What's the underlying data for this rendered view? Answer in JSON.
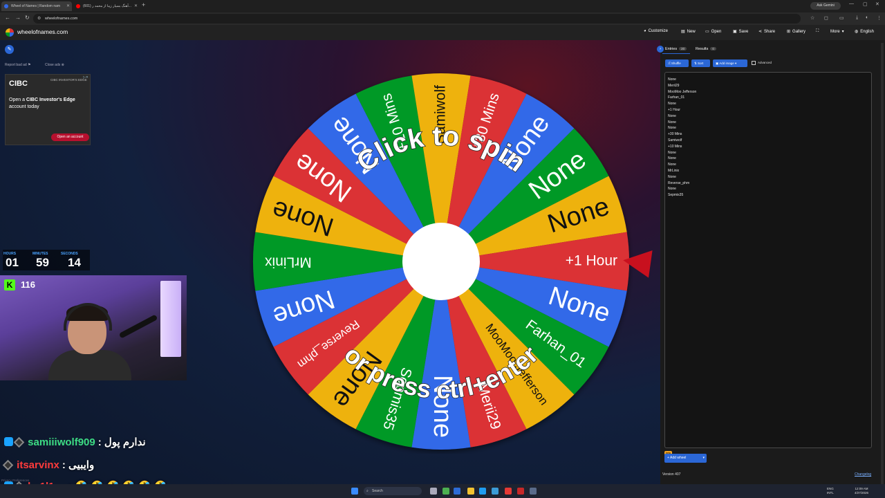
{
  "browser": {
    "tabs": [
      {
        "title": "Wheel of Names | Random nam",
        "favicon_color": "#3369e8"
      },
      {
        "title": "(601) آهنگ بسیار زیبا از محمد ر...",
        "favicon_color": "#ff0000"
      }
    ],
    "ask_gemini": "Ask Gemini",
    "url": "wheelofnames.com"
  },
  "header": {
    "site_name": "wheelofnames.com",
    "menu": [
      {
        "label": "Customize",
        "icon": "palette-icon"
      },
      {
        "label": "New",
        "icon": "file-icon"
      },
      {
        "label": "Open",
        "icon": "folder-icon"
      },
      {
        "label": "Save",
        "icon": "save-icon"
      },
      {
        "label": "Share",
        "icon": "share-icon"
      },
      {
        "label": "Gallery",
        "icon": "gallery-icon"
      },
      {
        "label": "",
        "icon": "fullscreen-icon"
      },
      {
        "label": "More",
        "icon": "chevron-down-icon"
      },
      {
        "label": "English",
        "icon": "globe-icon"
      }
    ]
  },
  "left": {
    "report_ad": "Report bad ad",
    "close_ads": "Close ads",
    "ad": {
      "brand": "CIBC",
      "product": "CIBC INVESTOR'S EDGE",
      "message_pre": "Open a ",
      "message_bold": "CIBC Investor's Edge",
      "message_post": " account today",
      "cta": "Open an account"
    }
  },
  "stream": {
    "timer": {
      "labels": [
        "HOURS",
        "MINUTES",
        "SECONDS"
      ],
      "values": [
        "01",
        "59",
        "14"
      ]
    },
    "kick_logo": "K",
    "viewers": "116",
    "chat": [
      {
        "user": "samiiiwolf909",
        "message": ": ندارم پول",
        "color": "#3ddc84"
      },
      {
        "user": "itsarvinx",
        "message": ": وایبیی",
        "color": "#ff3b3b"
      },
      {
        "user": "lm1l1ya",
        "message": ": 🤣 🤣 🤣 🤣 🤣 🤣",
        "color": "#ff3b3b"
      }
    ],
    "privacy": "Privacy Preferences"
  },
  "wheel": {
    "overlay_top": "Click to spin",
    "overlay_bottom": "or press ctrl+enter",
    "segments": [
      {
        "label": "None",
        "color": "#3369e8"
      },
      {
        "label": "None",
        "color": "#009925"
      },
      {
        "label": "None",
        "color": "#eeb211"
      },
      {
        "label": "+1 Hour",
        "color": "#db3236"
      },
      {
        "label": "None",
        "color": "#3369e8"
      },
      {
        "label": "Farhan_01",
        "color": "#009925"
      },
      {
        "label": "MooMoo Jefferson",
        "color": "#eeb211"
      },
      {
        "label": "Merii29",
        "color": "#db3236"
      },
      {
        "label": "None",
        "color": "#3369e8"
      },
      {
        "label": "Sepmis35",
        "color": "#009925"
      },
      {
        "label": "None",
        "color": "#eeb211"
      },
      {
        "label": "Reverse_phm",
        "color": "#db3236"
      },
      {
        "label": "None",
        "color": "#3369e8"
      },
      {
        "label": "MrLinix",
        "color": "#009925"
      },
      {
        "label": "None",
        "color": "#eeb211"
      },
      {
        "label": "None",
        "color": "#db3236"
      },
      {
        "label": "None",
        "color": "#3369e8"
      },
      {
        "label": "+10 Mins",
        "color": "#009925"
      },
      {
        "label": "Samiwolf",
        "color": "#eeb211"
      },
      {
        "label": "+30 Mins",
        "color": "#db3236"
      }
    ]
  },
  "panel": {
    "tabs": [
      {
        "label": "Entries",
        "count": "20"
      },
      {
        "label": "Results",
        "count": "0"
      }
    ],
    "buttons": [
      "Shuffle",
      "Sort",
      "Add image"
    ],
    "advanced": "Advanced",
    "entries": [
      "None",
      "Merii29",
      "MooMoo Jefferson",
      "Farhan_01",
      "None",
      "+1 Hour",
      "None",
      "None",
      "None",
      "+30 Mins",
      "Samiwolf",
      "+10 Mins",
      "None",
      "None",
      "None",
      "MrLinix",
      "None",
      "Reverse_phm",
      "None",
      "Sepmis35"
    ],
    "beta": "beta",
    "add_wheel": "Add wheel",
    "version": "Version 407",
    "changelog": "Changelog"
  },
  "taskbar": {
    "search": "Search",
    "lang": "ENG",
    "lang_sub": "INTL",
    "time": "12:09 AM",
    "date": "4/27/2026"
  }
}
